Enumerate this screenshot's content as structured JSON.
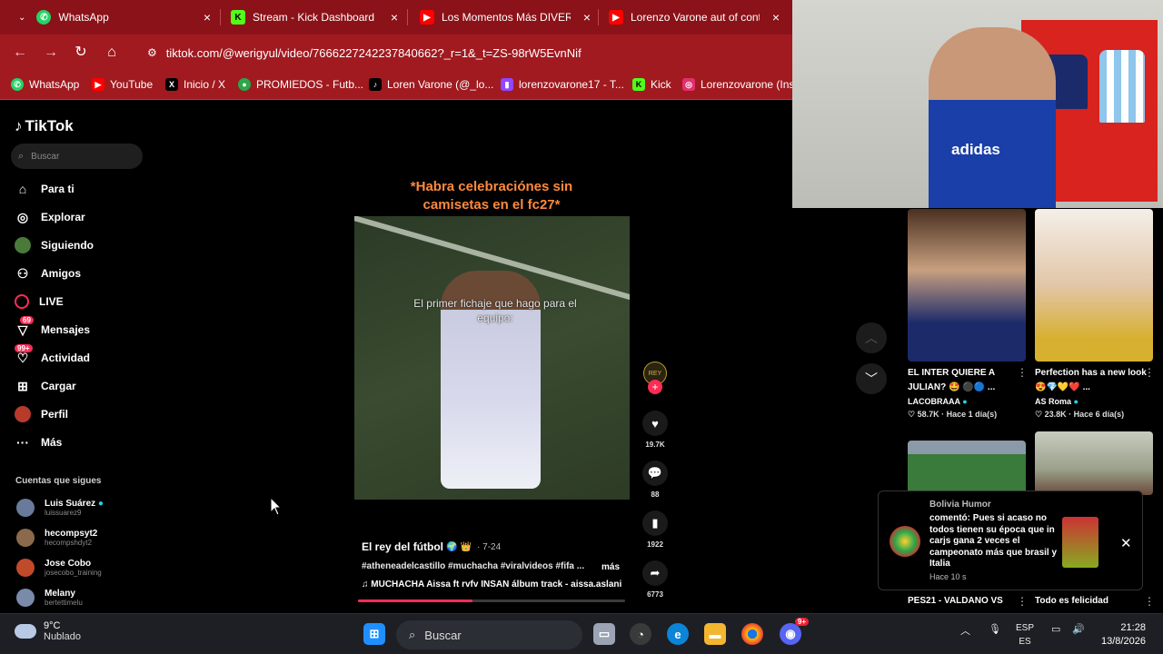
{
  "tabs": [
    {
      "title": "WhatsApp",
      "icon": "whatsapp-icon",
      "color": "#25d366"
    },
    {
      "title": "Stream - Kick Dashboard",
      "icon": "kick-icon",
      "color": "#53fc18"
    },
    {
      "title": "Los Momentos Más DIVERTIDOS",
      "icon": "youtube-icon",
      "color": "#ff0000"
    },
    {
      "title": "Lorenzo Varone aut of conte",
      "icon": "youtube-icon",
      "color": "#ff0000"
    }
  ],
  "address": {
    "host": "tiktok.com",
    "path": "/@werigyul/video/7666227242237840662?_r=1&_t=ZS-98rW5EvnNif"
  },
  "bookmarks": [
    {
      "label": "WhatsApp",
      "color": "#25d366"
    },
    {
      "label": "YouTube",
      "color": "#ff0000"
    },
    {
      "label": "Inicio / X",
      "color": "#000000"
    },
    {
      "label": "PROMIEDOS - Futb...",
      "color": "#2aa84a"
    },
    {
      "label": "Loren Varone (@_lo...",
      "color": "#000000"
    },
    {
      "label": "lorenzovarone17 - T...",
      "color": "#9146ff"
    },
    {
      "label": "Kick",
      "color": "#53fc18"
    },
    {
      "label": "Lorenzovarone (Inst...",
      "color": "#e1306c"
    }
  ],
  "tiktok": {
    "logo": "TikTok",
    "search_placeholder": "Buscar",
    "nav": [
      {
        "label": "Para ti",
        "icon": "home-icon"
      },
      {
        "label": "Explorar",
        "icon": "compass-icon"
      },
      {
        "label": "Siguiendo",
        "icon": "following-icon"
      },
      {
        "label": "Amigos",
        "icon": "friends-icon"
      },
      {
        "label": "LIVE",
        "icon": "live-icon"
      },
      {
        "label": "Mensajes",
        "icon": "messages-icon",
        "badge": "69"
      },
      {
        "label": "Actividad",
        "icon": "activity-icon",
        "badge": "99+"
      },
      {
        "label": "Cargar",
        "icon": "upload-icon"
      },
      {
        "label": "Perfil",
        "icon": "profile-icon"
      },
      {
        "label": "Más",
        "icon": "more-icon"
      }
    ],
    "following_title": "Cuentas que sigues",
    "following": [
      {
        "name": "Luis Suárez",
        "handle": "luissuarez9"
      },
      {
        "name": "hecompsyt2",
        "handle": "hecompshdyt2"
      },
      {
        "name": "Jose Cobo",
        "handle": "josecobo_training"
      },
      {
        "name": "Melany",
        "handle": "bertettimelu"
      }
    ]
  },
  "video": {
    "overlay_caption": "*Habra celebraciónes sin camisetas en el fc27*",
    "in_video_text": "El primer fichaje que hago para el equipo:",
    "author": "El rey del fútbol",
    "author_emoji": "🌍 👑",
    "date": "· 7-24",
    "tags": "#atheneadelcastillo #muchacha #viralvideos #fifa ...",
    "more": "más",
    "music": "♫  MUCHACHA Aissa ft rvfv INSAN álbum track - aissa.aslani",
    "progress": 0.43,
    "likes": "19.7K",
    "comments": "88",
    "saves": "1922",
    "shares": "6773"
  },
  "recommended": [
    {
      "title": "EL INTER QUIERE A JULIAN? 🤩 ⚫🔵 ...",
      "author": "LACOBRAAA",
      "stats": "♡ 58.7K · Hace 1 día(s)"
    },
    {
      "title": "Perfection has a new look 😍💎💛❤️ ...",
      "author": "AS Roma",
      "stats": "♡ 23.8K · Hace 6 día(s)"
    }
  ],
  "bottom_labels": [
    "PES21 - VALDANO VS",
    "Todo es felicidad"
  ],
  "notification": {
    "name": "Bolivia Humor",
    "text": "comentó: Pues si acaso no todos tienen su época que in carjs gana 2 veces el campeonato más que brasil y Italia",
    "time": "Hace 10 s"
  },
  "webcam": {
    "brand": "adidas"
  },
  "taskbar": {
    "weather_temp": "9°C",
    "weather_desc": "Nublado",
    "search": "Buscar",
    "lang1": "ESP",
    "lang2": "ES",
    "time": "21:28",
    "date": "13/8/2026",
    "discord_badge": "9+"
  }
}
